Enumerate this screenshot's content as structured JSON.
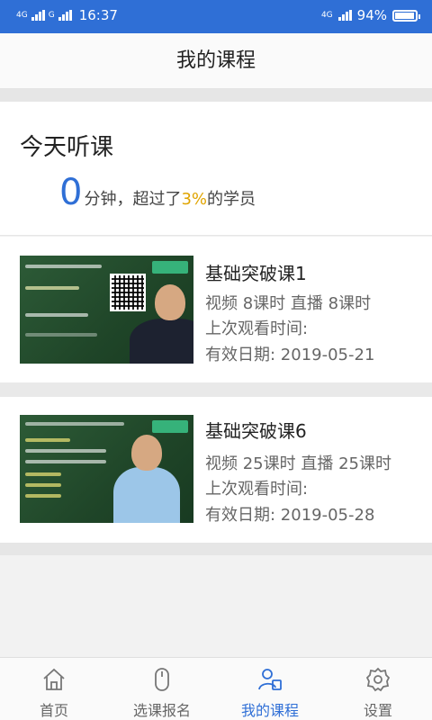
{
  "status_bar": {
    "network_left_1": "4G",
    "network_left_2": "G",
    "time": "16:37",
    "network_right": "4G",
    "battery": "94%",
    "battery_level": 0.94
  },
  "nav": {
    "title": "我的课程"
  },
  "today": {
    "title": "今天听课",
    "minutes": "0",
    "minutes_unit": "分钟，超过了",
    "percent": "3%",
    "suffix": "的学员"
  },
  "courses": [
    {
      "title": "基础突破课1",
      "hours": "视频 8课时  直播 8课时",
      "last_watched": "上次观看时间:",
      "valid_until": "有效日期: 2019-05-21"
    },
    {
      "title": "基础突破课6",
      "hours": "视频 25课时  直播 25课时",
      "last_watched": "上次观看时间:",
      "valid_until": "有效日期: 2019-05-28"
    }
  ],
  "tabbar": {
    "items": [
      {
        "label": "首页",
        "icon": "home-icon"
      },
      {
        "label": "选课报名",
        "icon": "mouse-icon"
      },
      {
        "label": "我的课程",
        "icon": "user-book-icon"
      },
      {
        "label": "设置",
        "icon": "gear-icon"
      }
    ],
    "active_index": 2
  },
  "colors": {
    "accent": "#2f6fd6",
    "highlight": "#e0a400"
  }
}
